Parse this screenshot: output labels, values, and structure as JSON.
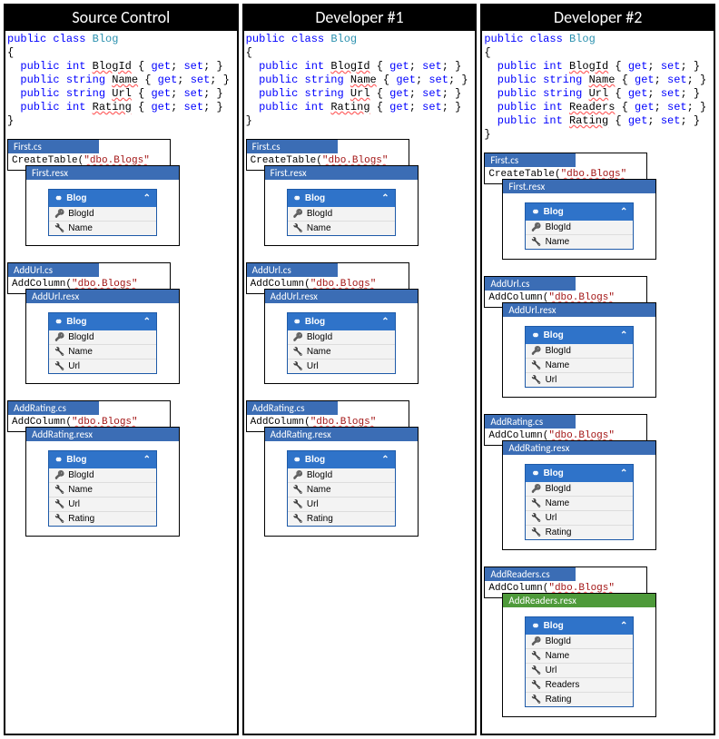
{
  "headers": [
    "Source Control",
    "Developer #1",
    "Developer #2"
  ],
  "code": {
    "sc": {
      "classDecl": {
        "kw1": "public",
        "kw2": "class",
        "name": "Blog"
      },
      "props": [
        {
          "kw": "public",
          "type": "int",
          "name": "BlogId"
        },
        {
          "kw": "public",
          "type": "string",
          "name": "Name"
        },
        {
          "kw": "public",
          "type": "string",
          "name": "Url"
        },
        {
          "kw": "public",
          "type": "int",
          "name": "Rating"
        }
      ]
    },
    "d1": {
      "classDecl": {
        "kw1": "public",
        "kw2": "class",
        "name": "Blog"
      },
      "props": [
        {
          "kw": "public",
          "type": "int",
          "name": "BlogId"
        },
        {
          "kw": "public",
          "type": "string",
          "name": "Name"
        },
        {
          "kw": "public",
          "type": "string",
          "name": "Url"
        },
        {
          "kw": "public",
          "type": "int",
          "name": "Rating"
        }
      ]
    },
    "d2": {
      "classDecl": {
        "kw1": "public",
        "kw2": "class",
        "name": "Blog"
      },
      "props": [
        {
          "kw": "public",
          "type": "int",
          "name": "BlogId"
        },
        {
          "kw": "public",
          "type": "string",
          "name": "Name"
        },
        {
          "kw": "public",
          "type": "string",
          "name": "Url"
        },
        {
          "kw": "public",
          "type": "int",
          "name": "Readers"
        },
        {
          "kw": "public",
          "type": "int",
          "name": "Rating"
        }
      ]
    },
    "propSuffix": " { get; set; }"
  },
  "entityName": "Blog",
  "migrations": {
    "sc": [
      {
        "cs": "First.cs",
        "call": "CreateTable(",
        "arg": "\"dbo.Blogs\"",
        "resx": "First.resx",
        "fields": [
          {
            "k": true,
            "n": "BlogId"
          },
          {
            "k": false,
            "n": "Name"
          }
        ]
      },
      {
        "cs": "AddUrl.cs",
        "call": "AddColumn(",
        "arg": "\"dbo.Blogs\"",
        "resx": "AddUrl.resx",
        "fields": [
          {
            "k": true,
            "n": "BlogId"
          },
          {
            "k": false,
            "n": "Name"
          },
          {
            "k": false,
            "n": "Url"
          }
        ]
      },
      {
        "cs": "AddRating.cs",
        "call": "AddColumn(",
        "arg": "\"dbo.Blogs\"",
        "resx": "AddRating.resx",
        "fields": [
          {
            "k": true,
            "n": "BlogId"
          },
          {
            "k": false,
            "n": "Name"
          },
          {
            "k": false,
            "n": "Url"
          },
          {
            "k": false,
            "n": "Rating"
          }
        ]
      }
    ],
    "d1": [
      {
        "cs": "First.cs",
        "call": "CreateTable(",
        "arg": "\"dbo.Blogs\"",
        "resx": "First.resx",
        "fields": [
          {
            "k": true,
            "n": "BlogId"
          },
          {
            "k": false,
            "n": "Name"
          }
        ]
      },
      {
        "cs": "AddUrl.cs",
        "call": "AddColumn(",
        "arg": "\"dbo.Blogs\"",
        "resx": "AddUrl.resx",
        "fields": [
          {
            "k": true,
            "n": "BlogId"
          },
          {
            "k": false,
            "n": "Name"
          },
          {
            "k": false,
            "n": "Url"
          }
        ]
      },
      {
        "cs": "AddRating.cs",
        "call": "AddColumn(",
        "arg": "\"dbo.Blogs\"",
        "resx": "AddRating.resx",
        "fields": [
          {
            "k": true,
            "n": "BlogId"
          },
          {
            "k": false,
            "n": "Name"
          },
          {
            "k": false,
            "n": "Url"
          },
          {
            "k": false,
            "n": "Rating"
          }
        ]
      }
    ],
    "d2": [
      {
        "cs": "First.cs",
        "call": "CreateTable(",
        "arg": "\"dbo.Blogs\"",
        "resx": "First.resx",
        "fields": [
          {
            "k": true,
            "n": "BlogId"
          },
          {
            "k": false,
            "n": "Name"
          }
        ]
      },
      {
        "cs": "AddUrl.cs",
        "call": "AddColumn(",
        "arg": "\"dbo.Blogs\"",
        "resx": "AddUrl.resx",
        "fields": [
          {
            "k": true,
            "n": "BlogId"
          },
          {
            "k": false,
            "n": "Name"
          },
          {
            "k": false,
            "n": "Url"
          }
        ]
      },
      {
        "cs": "AddRating.cs",
        "call": "AddColumn(",
        "arg": "\"dbo.Blogs\"",
        "resx": "AddRating.resx",
        "fields": [
          {
            "k": true,
            "n": "BlogId"
          },
          {
            "k": false,
            "n": "Name"
          },
          {
            "k": false,
            "n": "Url"
          },
          {
            "k": false,
            "n": "Rating"
          }
        ]
      },
      {
        "cs": "AddReaders.cs",
        "call": "AddColumn(",
        "arg": "\"dbo.Blogs\"",
        "resx": "AddReaders.resx",
        "green": true,
        "fields": [
          {
            "k": true,
            "n": "BlogId"
          },
          {
            "k": false,
            "n": "Name"
          },
          {
            "k": false,
            "n": "Url"
          },
          {
            "k": false,
            "n": "Readers"
          },
          {
            "k": false,
            "n": "Rating"
          }
        ]
      }
    ]
  }
}
